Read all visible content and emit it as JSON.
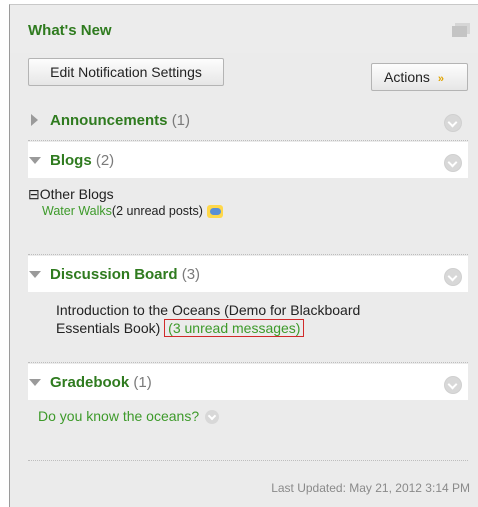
{
  "panel": {
    "title": "What's New",
    "edit_button": "Edit Notification Settings",
    "actions_button": "Actions",
    "actions_chevron": "»"
  },
  "sections": {
    "announcements": {
      "label": "Announcements",
      "count": "(1)"
    },
    "blogs": {
      "label": "Blogs",
      "count": "(2)",
      "group_label": "Other Blogs",
      "expand_symbol": "⊟",
      "item_link": "Water Walks",
      "item_status": "(2 unread posts)"
    },
    "discussion": {
      "label": "Discussion Board",
      "count": "(3)",
      "item_line1": "Introduction to the Oceans (Demo for Blackboard",
      "item_line2": "Essentials Book)",
      "unread_link": "(3 unread messages)"
    },
    "gradebook": {
      "label": "Gradebook",
      "count": "(1)",
      "item": "Do you know the oceans?"
    }
  },
  "footer": {
    "last_updated": "Last Updated: May 21, 2012 3:14 PM"
  },
  "colors": {
    "accent_green": "#2f7b1f",
    "link_green": "#3d9a2a",
    "highlight_red": "#d12a2a"
  }
}
